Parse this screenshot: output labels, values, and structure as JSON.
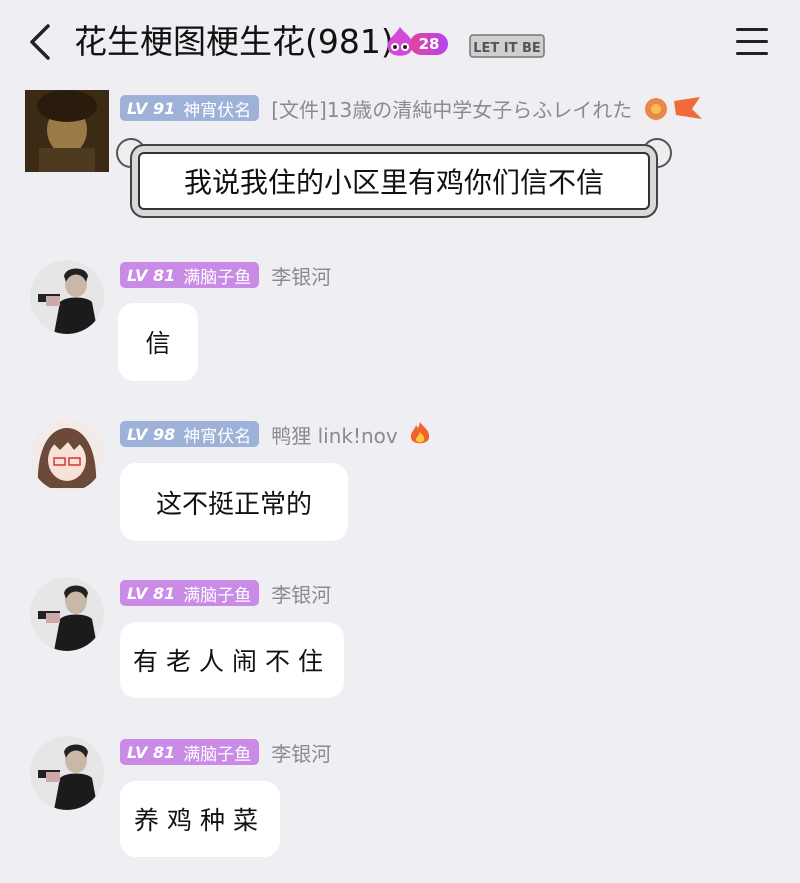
{
  "header": {
    "title": "花生梗图梗生花(981)",
    "fire_count": "28",
    "letitbe": "LET IT BE"
  },
  "messages": [
    {
      "badge_level": "LV 91",
      "badge_title": "神宵伏名",
      "nickname": "[文件]13歳の清純中学女子らふレイれた",
      "text": "我说我住的小区里有鸡你们信不信"
    },
    {
      "badge_level": "LV 81",
      "badge_title": "满脑子鱼",
      "nickname": "李银河",
      "text": "信"
    },
    {
      "badge_level": "LV 98",
      "badge_title": "神宵伏名",
      "nickname": "鸭狸 link!nov",
      "text": "这不挺正常的"
    },
    {
      "badge_level": "LV 81",
      "badge_title": "满脑子鱼",
      "nickname": "李银河",
      "text": "有老人闹不住"
    },
    {
      "badge_level": "LV 81",
      "badge_title": "满脑子鱼",
      "nickname": "李银河",
      "text": "养鸡种菜"
    }
  ],
  "colors": {
    "background": "#efeef3",
    "badge_blue": "#9eb2d9",
    "badge_purple": "#c98be5",
    "fire_badge": "#c545d0"
  }
}
